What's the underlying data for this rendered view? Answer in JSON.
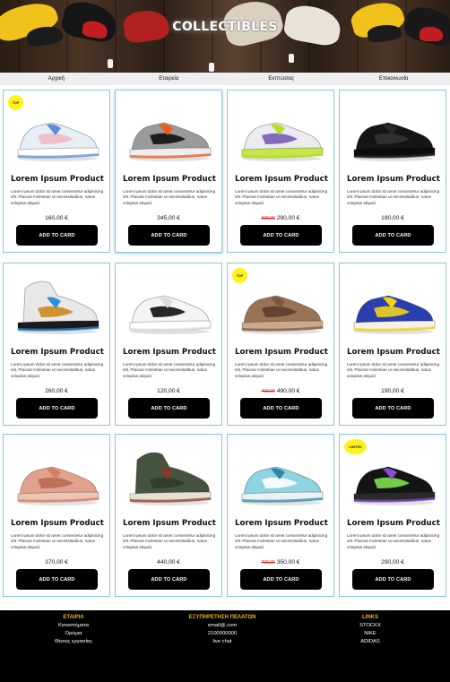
{
  "hero": {
    "title": "COLLECTIBLES"
  },
  "nav": {
    "items": [
      "Αρχική",
      "Εταιρεία",
      "Εκπτώσεις",
      "Επικοινωνία"
    ]
  },
  "products": [
    {
      "name": "Lorem Ipsum Product",
      "description": "Lorem ipsum dolor sit amet consectetur adipisicing elit. Placeat molestiae ut necessitatibus, natus voluptas aliquid,",
      "price": "160,00 €",
      "old_price": "",
      "badge": "TOP",
      "button": "ADD TO CARD",
      "shoe": "white-blue"
    },
    {
      "name": "Lorem Ipsum Product",
      "description": "Lorem ipsum dolor sit amet consectetur adipisicing elit. Placeat molestiae ut necessitatibus, natus voluptas aliquid,",
      "price": "345,00 €",
      "old_price": "",
      "badge": "",
      "button": "ADD TO CARD",
      "shoe": "grey-orange"
    },
    {
      "name": "Lorem Ipsum Product",
      "description": "Lorem ipsum dolor sit amet consectetur adipisicing elit. Placeat molestiae ut necessitatibus, natus voluptas aliquid,",
      "price": "290,00 €",
      "old_price": "600,00",
      "badge": "",
      "button": "ADD TO CARD",
      "shoe": "lime-purple"
    },
    {
      "name": "Lorem Ipsum Product",
      "description": "Lorem ipsum dolor sit amet consectetur adipisicing elit. Placeat molestiae ut necessitatibus, natus voluptas aliquid,",
      "price": "190,00 €",
      "old_price": "",
      "badge": "",
      "button": "ADD TO CARD",
      "shoe": "black"
    },
    {
      "name": "Lorem Ipsum Product",
      "description": "Lorem ipsum dolor sit amet consectetur adipisicing elit. Placeat molestiae ut necessitatibus, natus voluptas aliquid,",
      "price": "260,00 €",
      "old_price": "",
      "badge": "",
      "button": "ADD TO CARD",
      "shoe": "blue-black"
    },
    {
      "name": "Lorem Ipsum Product",
      "description": "Lorem ipsum dolor sit amet consectetur adipisicing elit. Placeat molestiae ut necessitatibus, natus voluptas aliquid,",
      "price": "120,00 €",
      "old_price": "",
      "badge": "",
      "button": "ADD TO CARD",
      "shoe": "white"
    },
    {
      "name": "Lorem Ipsum Product",
      "description": "Lorem ipsum dolor sit amet consectetur adipisicing elit. Placeat molestiae ut necessitatibus, natus voluptas aliquid,",
      "price": "490,00 €",
      "old_price": "700,00",
      "badge": "TOP",
      "button": "ADD TO CARD",
      "shoe": "brown"
    },
    {
      "name": "Lorem Ipsum Product",
      "description": "Lorem ipsum dolor sit amet consectetur adipisicing elit. Placeat molestiae ut necessitatibus, natus voluptas aliquid,",
      "price": "190,00 €",
      "old_price": "",
      "badge": "",
      "button": "ADD TO CARD",
      "shoe": "blue-yellow"
    },
    {
      "name": "Lorem Ipsum Product",
      "description": "Lorem ipsum dolor sit amet consectetur adipisicing elit. Placeat molestiae ut necessitatibus, natus voluptas aliquid,",
      "price": "370,00 €",
      "old_price": "",
      "badge": "",
      "button": "ADD TO CARD",
      "shoe": "salmon"
    },
    {
      "name": "Lorem Ipsum Product",
      "description": "Lorem ipsum dolor sit amet consectetur adipisicing elit. Placeat molestiae ut necessitatibus, natus voluptas aliquid,",
      "price": "440,00 €",
      "old_price": "",
      "badge": "",
      "button": "ADD TO CARD",
      "shoe": "green-hightop"
    },
    {
      "name": "Lorem Ipsum Product",
      "description": "Lorem ipsum dolor sit amet consectetur adipisicing elit. Placeat molestiae ut necessitatibus, natus voluptas aliquid,",
      "price": "350,00 €",
      "old_price": "700,00",
      "badge": "",
      "button": "ADD TO CARD",
      "shoe": "teal-runner"
    },
    {
      "name": "Lorem Ipsum Product",
      "description": "Lorem ipsum dolor sit amet consectetur adipisicing elit. Placeat molestiae ut necessitatibus, natus voluptas aliquid,",
      "price": "290,00 €",
      "old_price": "",
      "badge": "LIMITED",
      "button": "ADD TO CARD",
      "shoe": "black-purple"
    }
  ],
  "footer": {
    "columns": [
      {
        "heading": "ΕΤΑΙΡΙΑ",
        "links": [
          "Καταστήματα",
          "Ορόμια",
          "Θέσεις εργασίας"
        ]
      },
      {
        "heading": "ΕΞΥΠΗΡΕΤΗΣΗ ΠΕΛΑΤΩΝ",
        "links": [
          "email@.com",
          "2100000000",
          "live chat"
        ]
      },
      {
        "heading": "LINKS",
        "links": [
          "STOCKX",
          "NIKE",
          "ADIDAS"
        ]
      }
    ]
  },
  "colors": {
    "card_border": "#8ac6d6",
    "footer_heading": "#f0b21a",
    "badge": "#fff21a",
    "old_price": "#cc1f1f"
  }
}
